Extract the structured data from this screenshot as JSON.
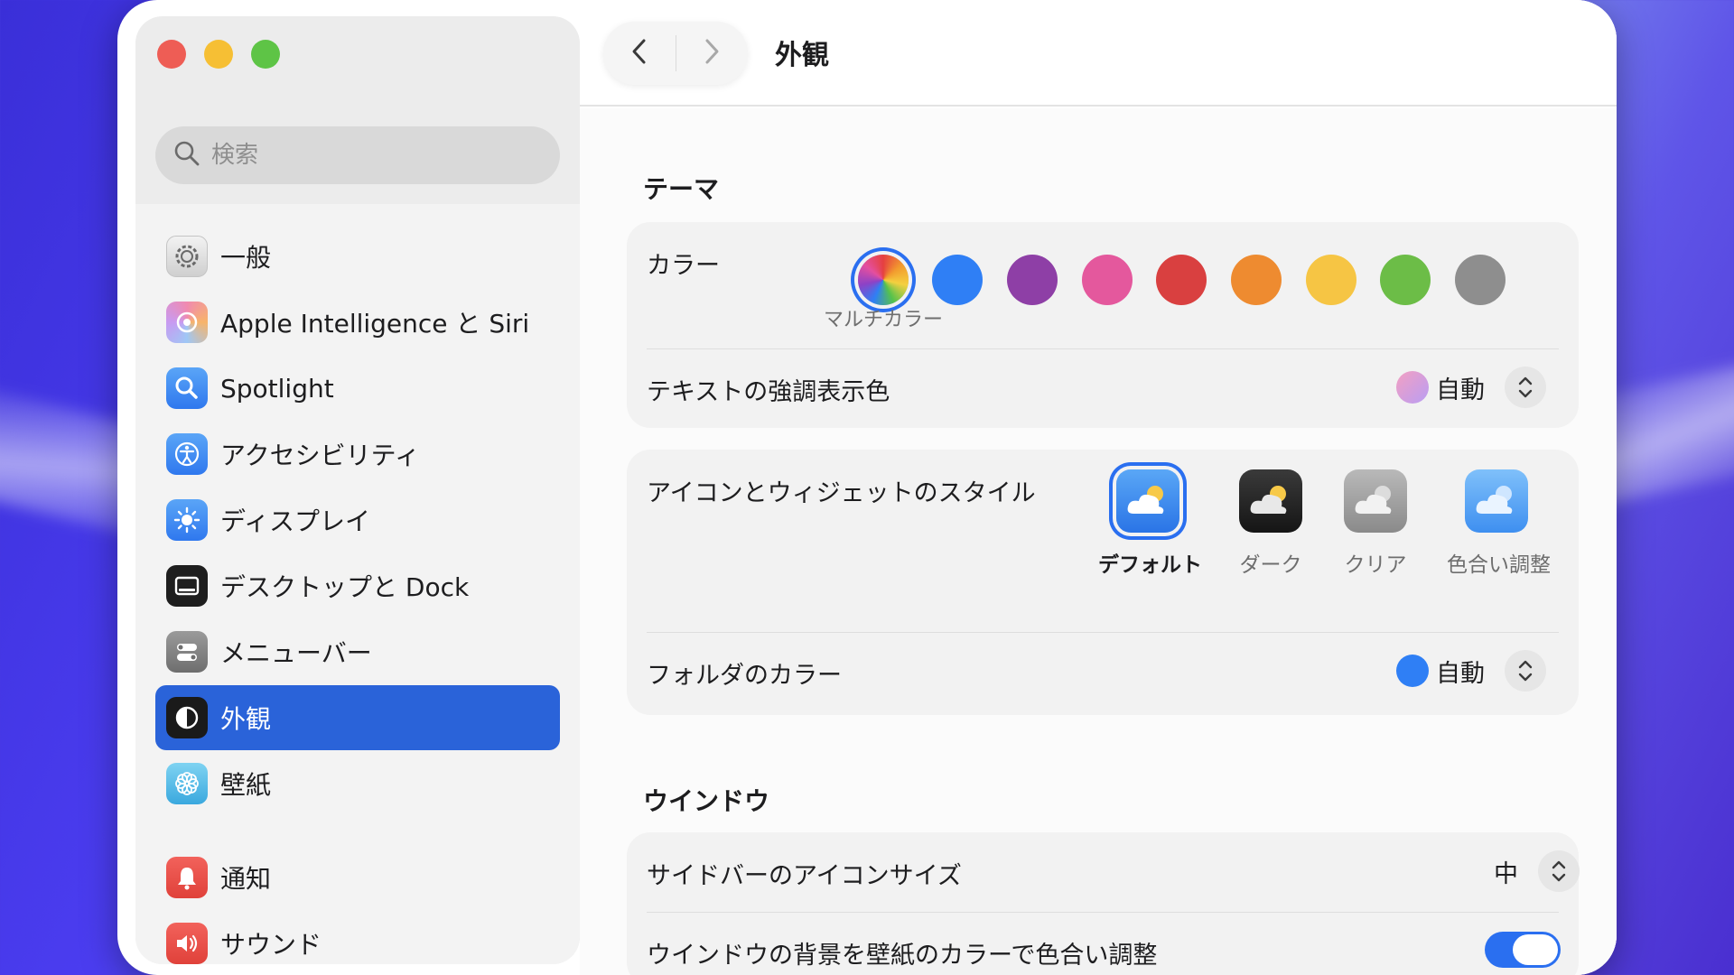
{
  "window": {
    "title": "外観"
  },
  "search": {
    "placeholder": "検索"
  },
  "sidebar": {
    "items": [
      {
        "label": "一般",
        "icon": "gear-icon"
      },
      {
        "label": "Apple Intelligence と Siri",
        "icon": "siri-icon"
      },
      {
        "label": "Spotlight",
        "icon": "magnifier-icon"
      },
      {
        "label": "アクセシビリティ",
        "icon": "accessibility-icon"
      },
      {
        "label": "ディスプレイ",
        "icon": "brightness-icon"
      },
      {
        "label": "デスクトップと Dock",
        "icon": "dock-icon"
      },
      {
        "label": "メニューバー",
        "icon": "menubar-icon"
      },
      {
        "label": "外観",
        "icon": "appearance-icon",
        "selected": true
      },
      {
        "label": "壁紙",
        "icon": "flower-icon"
      },
      {
        "label": "通知",
        "icon": "bell-icon"
      },
      {
        "label": "サウンド",
        "icon": "speaker-icon"
      }
    ]
  },
  "theme": {
    "section_title": "テーマ",
    "color_label": "カラー",
    "selected_caption": "マルチカラー",
    "swatches": [
      "multicolor",
      "#2f7ff5",
      "#8e3fa6",
      "#e4589d",
      "#d94040",
      "#ee8b30",
      "#f6c544",
      "#6cbd47",
      "#8e8e8e"
    ],
    "highlight_label": "テキストの強調表示色",
    "highlight_value": "自動"
  },
  "icons": {
    "label": "アイコンとウィジェットのスタイル",
    "options": [
      {
        "label": "デフォルト",
        "selected": true
      },
      {
        "label": "ダーク"
      },
      {
        "label": "クリア"
      },
      {
        "label": "色合い調整"
      }
    ],
    "folder_label": "フォルダのカラー",
    "folder_value": "自動"
  },
  "window_section": {
    "section_title": "ウインドウ",
    "sidebar_icon_label": "サイドバーのアイコンサイズ",
    "sidebar_icon_value": "中",
    "tint_label": "ウインドウの背景を壁紙のカラーで色合い調整",
    "tint_enabled": true
  },
  "colors": {
    "accent": "#2a6ff0",
    "selection": "#2a63d9"
  }
}
